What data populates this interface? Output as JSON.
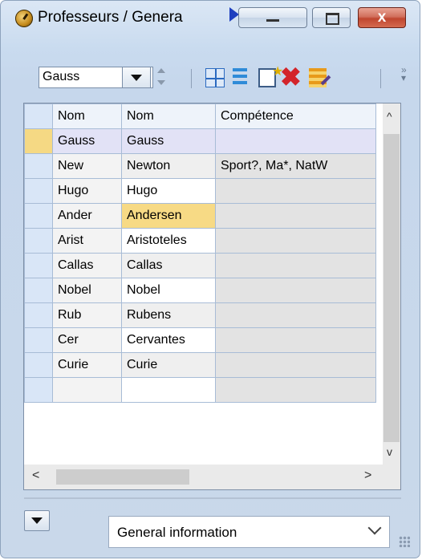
{
  "window": {
    "title": "Professeurs / Genera",
    "close_label": "x",
    "icons": {
      "app": "clock-icon",
      "overflow": "play-arrow-icon"
    }
  },
  "toolbar": {
    "combo_value": "Gauss",
    "icons": [
      "dropdown-icon",
      "spinner-icon",
      "grid-icon",
      "list-icon",
      "new-record-icon",
      "delete-icon",
      "edit-icon",
      "more-icon"
    ]
  },
  "table": {
    "columns": [
      "Nom",
      "Nom",
      "Compétence"
    ],
    "rows": [
      {
        "c1": "Gauss",
        "c2": "Gauss",
        "c3": ""
      },
      {
        "c1": "New",
        "c2": "Newton",
        "c3": "Sport?, Ma*, NatW"
      },
      {
        "c1": "Hugo",
        "c2": "Hugo",
        "c3": ""
      },
      {
        "c1": "Ander",
        "c2": "Andersen",
        "c3": ""
      },
      {
        "c1": "Arist",
        "c2": "Aristoteles",
        "c3": ""
      },
      {
        "c1": "Callas",
        "c2": "Callas",
        "c3": ""
      },
      {
        "c1": "Nobel",
        "c2": "Nobel",
        "c3": ""
      },
      {
        "c1": "Rub",
        "c2": "Rubens",
        "c3": ""
      },
      {
        "c1": "Cer",
        "c2": "Cervantes",
        "c3": ""
      },
      {
        "c1": "Curie",
        "c2": "Curie",
        "c3": ""
      },
      {
        "c1": "",
        "c2": "",
        "c3": ""
      }
    ],
    "selected_row": 0,
    "highlighted_cell": "Andersen"
  },
  "footer": {
    "view_select": "General information"
  },
  "colors": {
    "selection": "#f7da85",
    "row_header": "#d9e6f7",
    "close": "#c0462f"
  }
}
